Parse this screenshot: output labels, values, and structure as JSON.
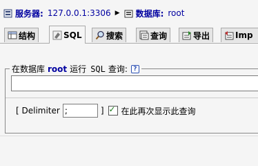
{
  "breadcrumb": {
    "server_label": "服务器:",
    "server_value": "127.0.0.1:3306",
    "separator": "▶",
    "database_label": "数据库:",
    "database_value": "root"
  },
  "tabs": [
    {
      "label": "结构",
      "icon": "table-structure-icon"
    },
    {
      "label": "SQL",
      "icon": "sql-icon",
      "active": true
    },
    {
      "label": "搜索",
      "icon": "search-icon"
    },
    {
      "label": "查询",
      "icon": "query-icon"
    },
    {
      "label": "导出",
      "icon": "export-icon"
    },
    {
      "label": "Imp",
      "icon": "import-icon"
    }
  ],
  "query_panel": {
    "legend_prefix": "在数据库",
    "legend_db": "root",
    "legend_run": "运行",
    "legend_sql": "SQL",
    "legend_suffix": "查询:",
    "help_glyph": "?",
    "sql_text": ""
  },
  "delimiter": {
    "open_bracket": "[ Delimiter",
    "value": ";",
    "close_bracket": "]"
  },
  "show_again": {
    "label": "在此再次显示此查询",
    "checked": true
  }
}
